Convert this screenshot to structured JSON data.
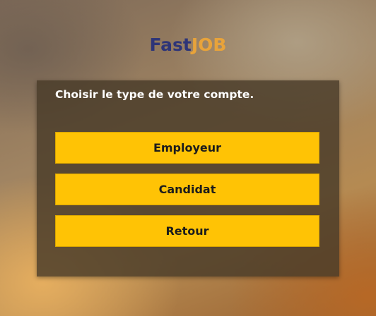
{
  "logo": {
    "part1": "Fast",
    "part2": "JOB"
  },
  "panel": {
    "title": "Choisir le type de votre compte."
  },
  "buttons": {
    "employer": "Employeur",
    "candidat": "Candidat",
    "retour": "Retour"
  },
  "colors": {
    "logo_primary": "#2e3578",
    "logo_accent": "#e8a33a",
    "button_background": "#ffc305",
    "panel_background": "#483a28"
  }
}
